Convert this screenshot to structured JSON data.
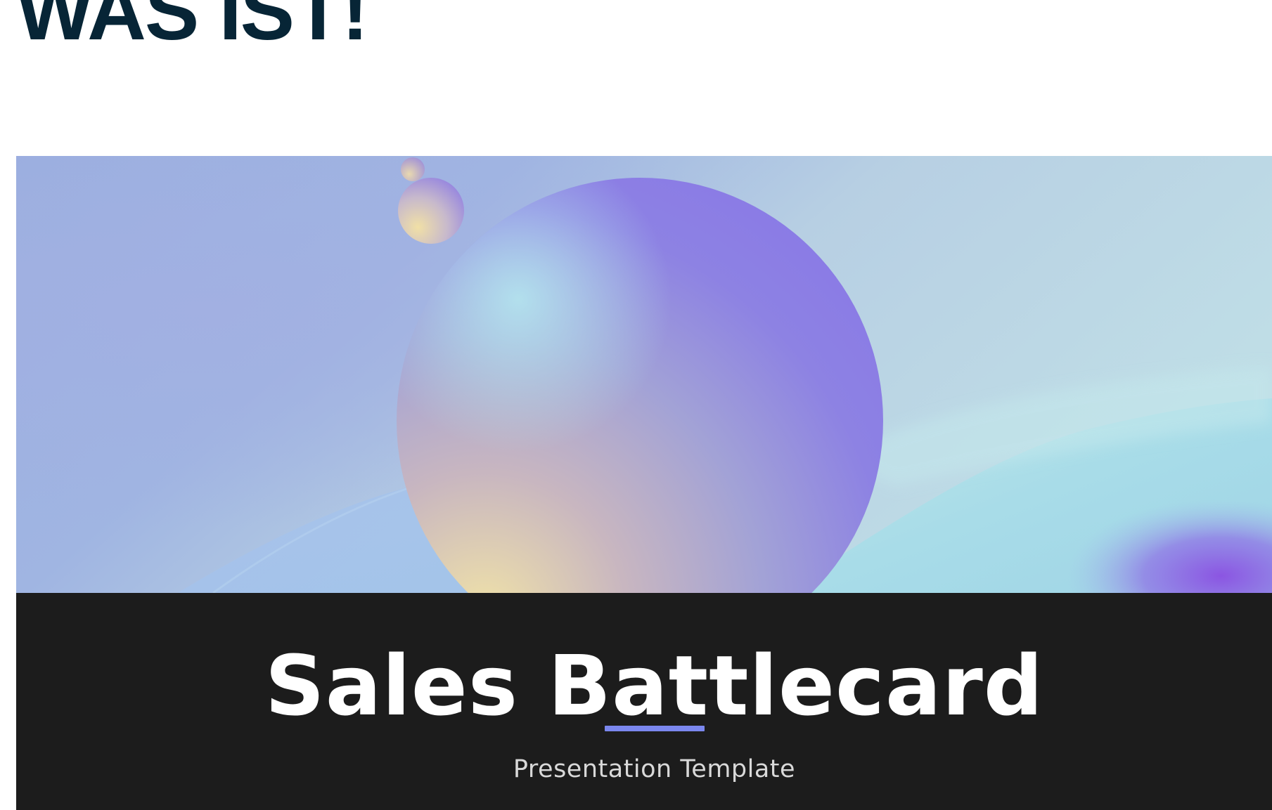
{
  "page": {
    "heading": "WAS IST!"
  },
  "slide": {
    "title": "Sales Battlecard",
    "subtitle": "Presentation Template"
  },
  "colors": {
    "heading_text": "#072536",
    "banner_bg": "#1c1c1c",
    "title_text": "#ffffff",
    "subtitle_text": "#d9d9d9",
    "accent_line": "#7b87ee"
  },
  "icons": {
    "hero": "abstract-spheres-illustration"
  }
}
